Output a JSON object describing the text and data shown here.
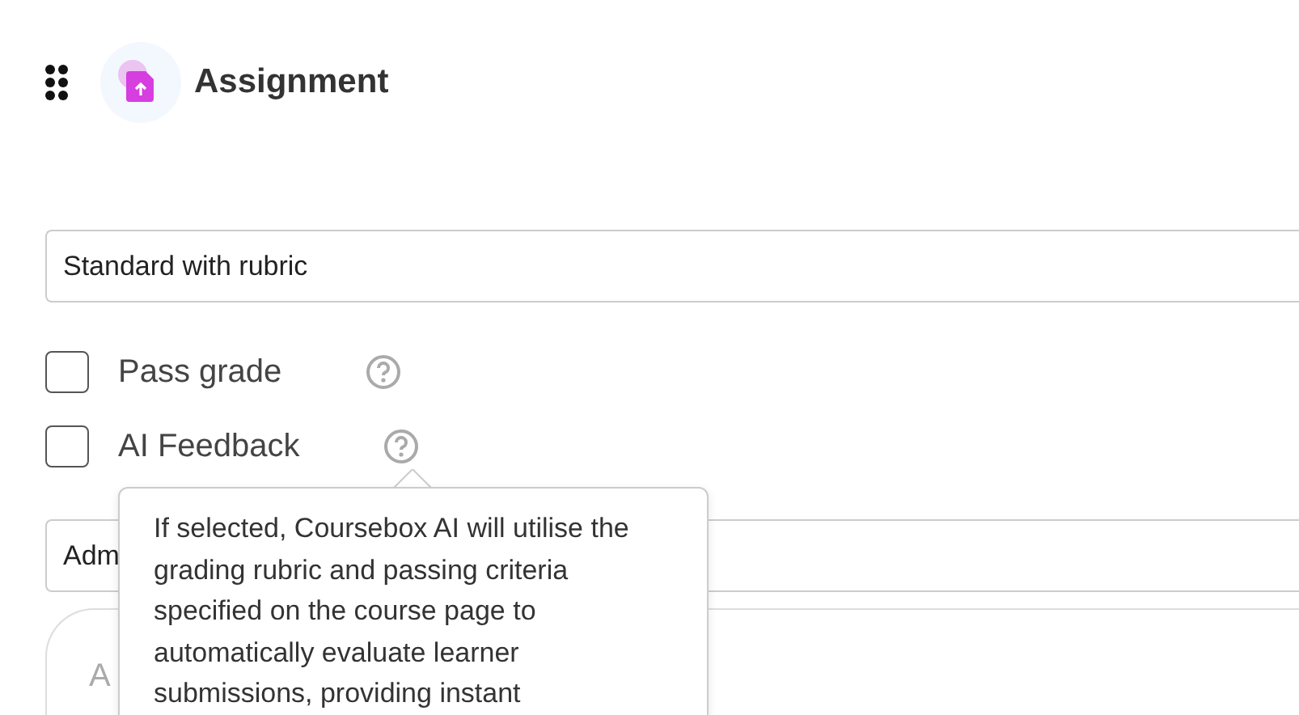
{
  "header": {
    "title": "Assignment"
  },
  "grading_type": {
    "value": "Standard with rubric"
  },
  "options": [
    {
      "label": "Pass grade",
      "checked": false
    },
    {
      "label": "AI Feedback",
      "checked": false
    }
  ],
  "tooltip": {
    "text": "If selected, Coursebox AI will utilise the grading rubric and passing criteria specified on the course page to automatically evaluate learner submissions, providing instant"
  },
  "field_2": {
    "value": "Adm"
  },
  "instructions": {
    "placeholder": "A"
  }
}
